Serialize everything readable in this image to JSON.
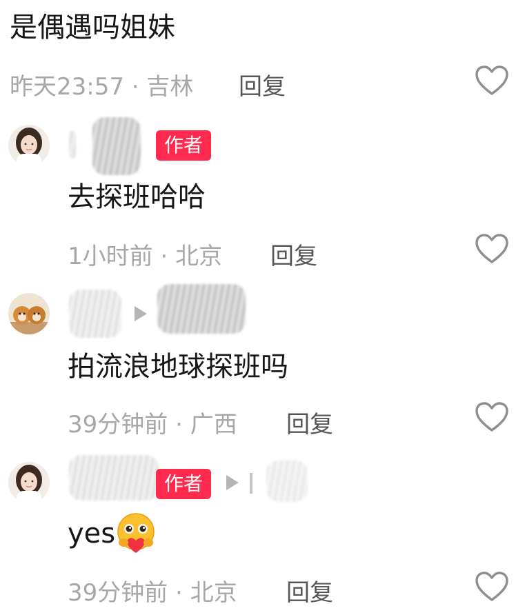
{
  "reply_label": "回复",
  "author_badge": "作者",
  "comments": [
    {
      "text": "是偶遇吗姐妹",
      "time": "昨天23:57",
      "separator": "·",
      "location": "吉林"
    },
    {
      "text": "去探班哈哈",
      "time": "1小时前",
      "separator": "·",
      "location": "北京"
    },
    {
      "text": "拍流浪地球探班吗",
      "time": "39分钟前",
      "separator": "·",
      "location": "广西"
    },
    {
      "text": "yes",
      "time": "39分钟前",
      "separator": "·",
      "location": "北京"
    }
  ],
  "icons": {
    "like": "heart-outline-icon",
    "reply_arrow": "play-arrow-icon",
    "emoji": "hugging-face-emoji"
  },
  "colors": {
    "badge": "#ff2a4e",
    "meta_text": "#a7a7a7",
    "reply_text": "#555555",
    "heart_outline": "#8e8e8e"
  }
}
